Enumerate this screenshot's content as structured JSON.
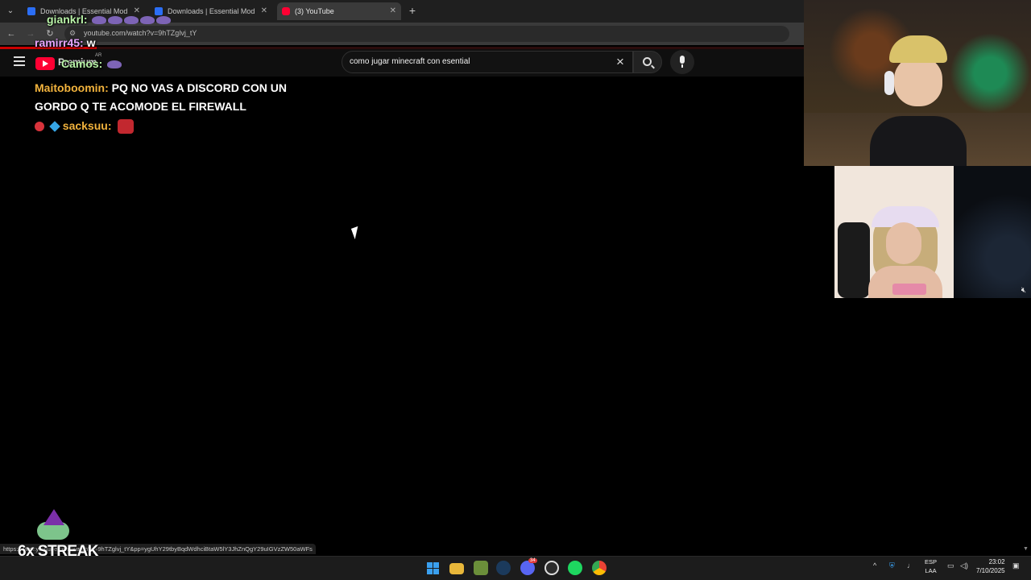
{
  "browser": {
    "tabs": [
      {
        "title": "Downloads | Essential Mod",
        "active": false
      },
      {
        "title": "Downloads | Essential Mod",
        "active": false
      },
      {
        "title": "(3) YouTube",
        "active": true
      }
    ],
    "tab_close": "✕",
    "new_tab": "+",
    "url": "youtube.com/watch?v=9hTZglvj_tY",
    "status_url": "https://www.youtube.com/watch?v=9hTZglvj_tY&pp=ygUhY29tbyBqdWdhciBtaW5lY3JhZnQgY29uIGVzZW50aWFs"
  },
  "youtube": {
    "logo_text": "Premium",
    "region": "AR",
    "search_value": "como jugar minecraft con esential"
  },
  "chat": {
    "overlay": [
      {
        "user": "giankrl:",
        "message": "",
        "color": "#b9f3a8"
      },
      {
        "user": "ramirr45:",
        "message": "w",
        "color": "#e8a6ff"
      },
      {
        "user": "Camos:",
        "message": "",
        "color": "#b9f3a8"
      }
    ],
    "main_user": "Maitoboomin:",
    "main_message": "PQ NO VAS A DISCORD CON UN GORDO Q TE ACOMODE EL FIREWALL",
    "second_user": "sacksuu:"
  },
  "streak": {
    "label": "6x STREAK"
  },
  "taskbar": {
    "language": "ESP",
    "layout": "LAA",
    "time": "23:02",
    "date": "7/10/2025",
    "discord_badge": "34"
  },
  "colors": {
    "youtube_red": "#ff0033",
    "chat_name_yellow": "#f2b33d"
  }
}
